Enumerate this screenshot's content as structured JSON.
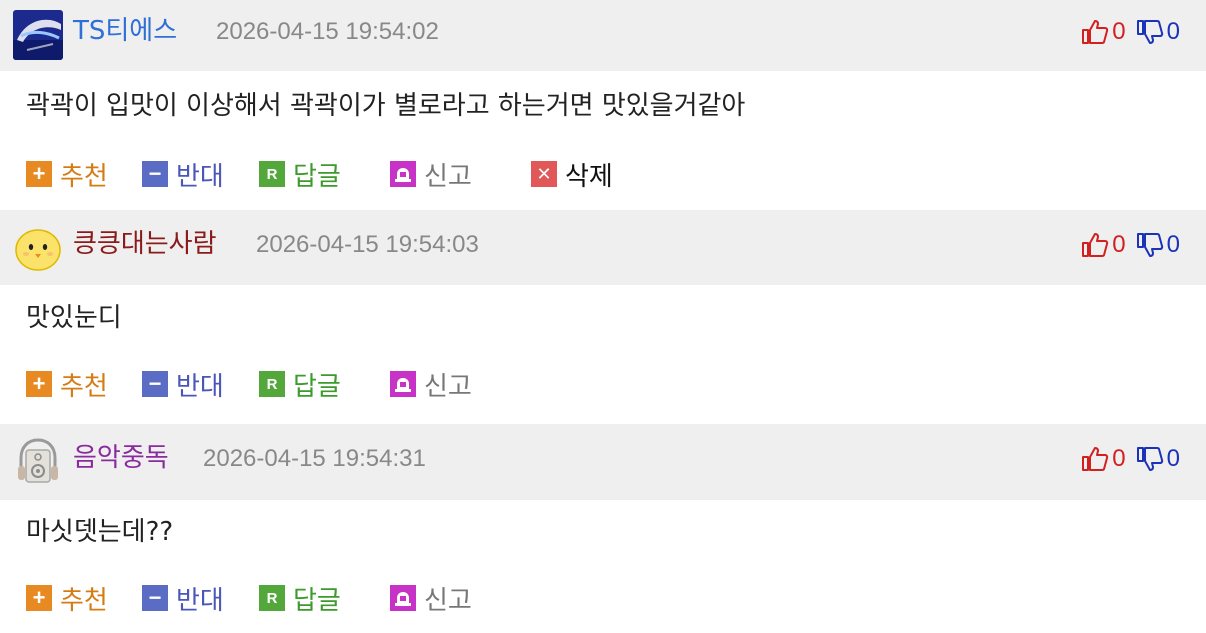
{
  "comments": [
    {
      "nickname": "TS티에스",
      "nickname_color": "#2f6fd8",
      "datetime": "2026-04-15 19:54:02",
      "upvotes": "0",
      "downvotes": "0",
      "text": "곽곽이 입맛이 이상해서 곽곽이가 별로라고 하는거면 맛있을거같아",
      "actions": {
        "recommend": "추천",
        "oppose": "반대",
        "reply": "답글",
        "report": "신고",
        "delete": "삭제"
      }
    },
    {
      "nickname": "킁킁대는사람",
      "nickname_color": "#8b1a1a",
      "datetime": "2026-04-15 19:54:03",
      "upvotes": "0",
      "downvotes": "0",
      "text": "맛있눈디",
      "actions": {
        "recommend": "추천",
        "oppose": "반대",
        "reply": "답글",
        "report": "신고"
      }
    },
    {
      "nickname": "음악중독",
      "nickname_color": "#8a2a9e",
      "datetime": "2026-04-15 19:54:31",
      "upvotes": "0",
      "downvotes": "0",
      "text": "마싯뎃는데??",
      "actions": {
        "recommend": "추천",
        "oppose": "반대",
        "reply": "답글",
        "report": "신고"
      }
    }
  ],
  "icons": {
    "recommend": "plus-icon",
    "oppose": "minus-icon",
    "reply": "reply-icon",
    "report": "siren-icon",
    "delete": "delete-icon",
    "upvote": "thumbs-up-icon",
    "downvote": "thumbs-down-icon"
  }
}
